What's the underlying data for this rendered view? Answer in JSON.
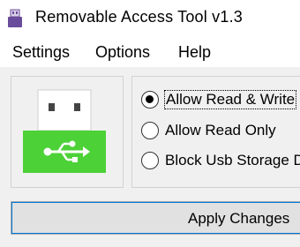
{
  "window": {
    "title": "Removable Access Tool v1.3",
    "icon": "usb-drive-icon"
  },
  "menu": {
    "items": [
      {
        "label": "Settings"
      },
      {
        "label": "Options"
      },
      {
        "label": "Help"
      }
    ]
  },
  "illustration": {
    "icon": "usb-drive-icon",
    "accent": "#4cd137"
  },
  "access_mode": {
    "selected": "Allow Read & Write",
    "options": [
      {
        "label": "Allow Read & Write",
        "checked": true
      },
      {
        "label": "Allow Read Only",
        "checked": false
      },
      {
        "label": "Block Usb Storage D",
        "checked": false
      }
    ]
  },
  "actions": {
    "apply_label": "Apply Changes"
  },
  "colors": {
    "background": "#f0f0f0",
    "button_border_focus": "#0078d7",
    "usb_green": "#4cd137"
  }
}
